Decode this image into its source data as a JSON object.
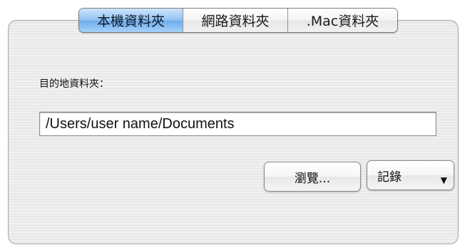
{
  "tabs": [
    {
      "label": "本機資料夾",
      "selected": true
    },
    {
      "label": "網路資料夾",
      "selected": false
    },
    {
      "label": ".Mac資料夾",
      "selected": false
    }
  ],
  "destination": {
    "label": "目的地資料夾：",
    "value": "/Users/user name/Documents"
  },
  "buttons": {
    "browse_label": "瀏覽...",
    "history_label": "記錄",
    "history_arrow_icon": "triangle-down-icon"
  },
  "colors": {
    "selected_tab": "#8fc0f2",
    "panel_background": "#eeeeee"
  }
}
